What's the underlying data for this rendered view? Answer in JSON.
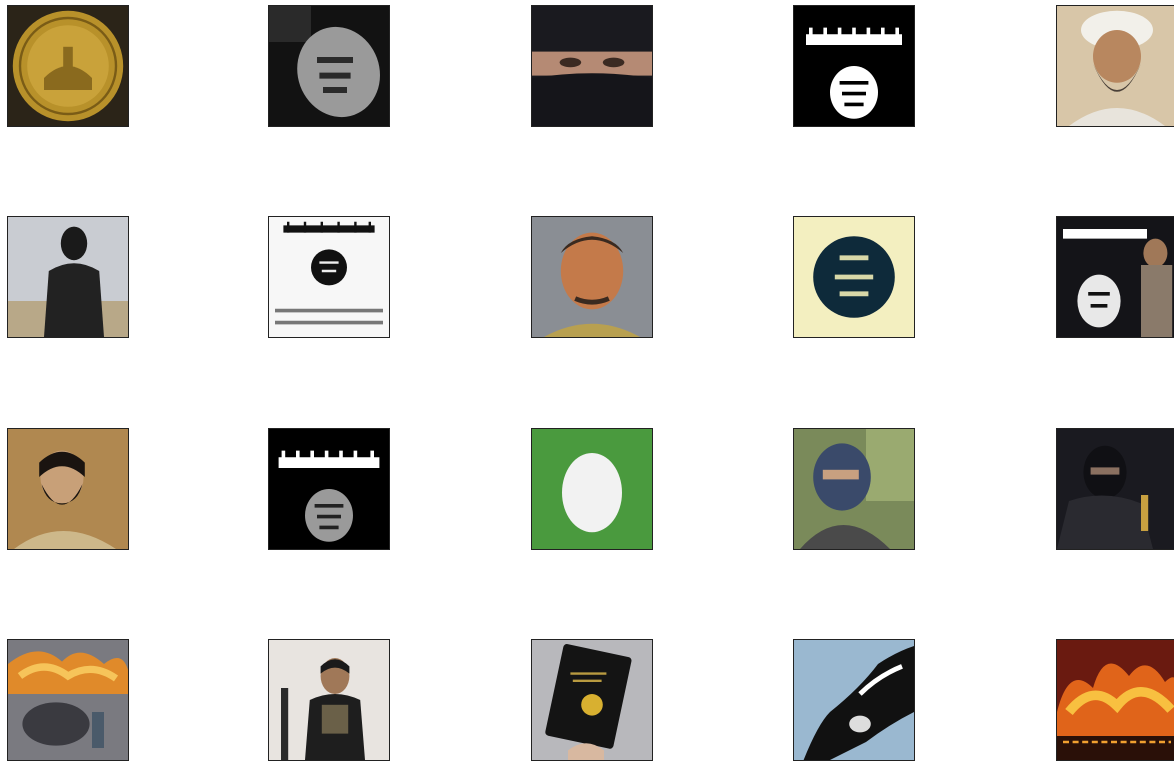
{
  "grid": {
    "rows": 4,
    "columns": 5,
    "thumbnails": [
      {
        "icon": "gold-coin-icon"
      },
      {
        "icon": "dark-seal-icon"
      },
      {
        "icon": "masked-face-photo"
      },
      {
        "icon": "black-flag-icon"
      },
      {
        "icon": "bearded-man-portrait"
      },
      {
        "icon": "masked-figure-desert-photo"
      },
      {
        "icon": "white-flag-with-seal-icon"
      },
      {
        "icon": "man-portrait-photo"
      },
      {
        "icon": "cream-seal-icon"
      },
      {
        "icon": "flag-with-person-photo"
      },
      {
        "icon": "bearded-man-photo"
      },
      {
        "icon": "black-flag-icon"
      },
      {
        "icon": "default-egg-avatar-icon"
      },
      {
        "icon": "masked-man-outdoor-photo"
      },
      {
        "icon": "masked-man-dark-photo"
      },
      {
        "icon": "fire-scene-photo"
      },
      {
        "icon": "armed-man-photo"
      },
      {
        "icon": "passport-in-hand-photo"
      },
      {
        "icon": "waving-flag-photo"
      },
      {
        "icon": "burning-building-photo"
      }
    ],
    "colors": {
      "border": "#222222",
      "egg_green": "#4a9a3e",
      "egg_white": "#f2f2f2",
      "coin_gold": "#b8912a",
      "cream_bg": "#f3efc0",
      "seal_navy": "#0e2a3a"
    }
  }
}
